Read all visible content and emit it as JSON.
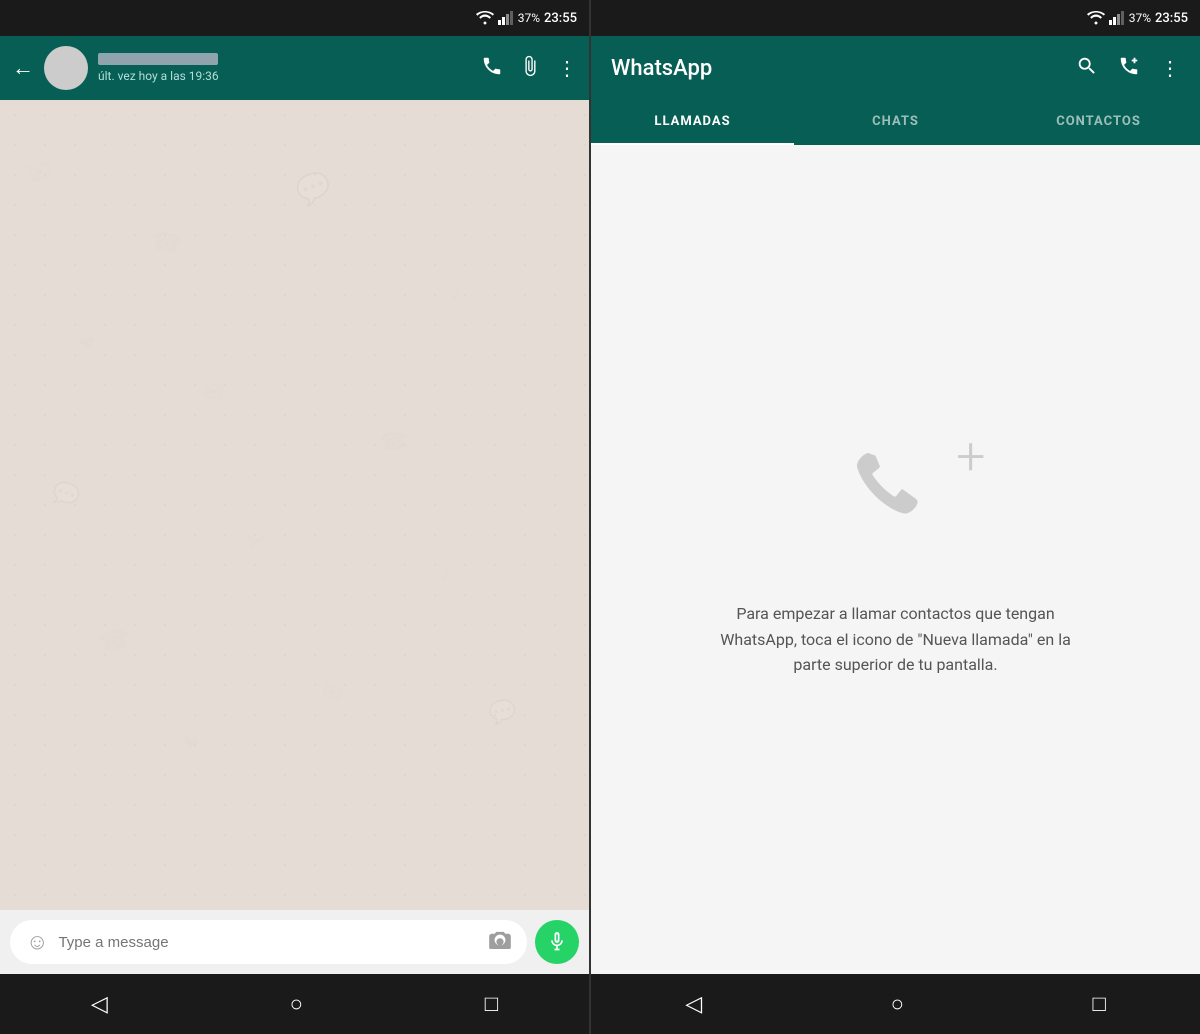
{
  "left": {
    "statusBar": {
      "signal": "📶",
      "battery": "37%",
      "time": "23:55"
    },
    "header": {
      "backLabel": "←",
      "contactStatus": "últ. vez hoy a las 19:36",
      "callIcon": "✆",
      "attachIcon": "⊘",
      "moreIcon": "⋮"
    },
    "input": {
      "placeholder": "Type a message",
      "emojiIcon": "☺",
      "cameraIcon": "📷",
      "micIcon": "🎤"
    },
    "nav": {
      "back": "◁",
      "home": "○",
      "recent": "□"
    }
  },
  "right": {
    "statusBar": {
      "signal": "📶",
      "battery": "37%",
      "time": "23:55"
    },
    "header": {
      "title": "WhatsApp",
      "searchIcon": "🔍",
      "newCallIcon": "📞",
      "moreIcon": "⋮"
    },
    "tabs": [
      {
        "id": "llamadas",
        "label": "LLAMADAS",
        "active": true
      },
      {
        "id": "chats",
        "label": "CHATS",
        "active": false
      },
      {
        "id": "contactos",
        "label": "CONTACTOS",
        "active": false
      }
    ],
    "callsContent": {
      "description": "Para empezar a llamar contactos que tengan WhatsApp, toca el icono de \"Nueva llamada\" en la parte superior de tu pantalla."
    },
    "nav": {
      "back": "◁",
      "home": "○",
      "recent": "□"
    }
  }
}
